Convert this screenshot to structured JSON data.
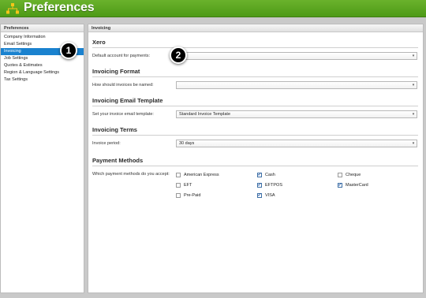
{
  "app": {
    "title": "Preferences",
    "logo_icon": "org-chart-icon"
  },
  "sidebar": {
    "heading": "Preferences",
    "items": [
      {
        "label": "Company Information"
      },
      {
        "label": "Email Settings"
      },
      {
        "label": "Invoicing",
        "active": true
      },
      {
        "label": "Job Settings"
      },
      {
        "label": "Quotes & Estimates"
      },
      {
        "label": "Region & Language Settings"
      },
      {
        "label": "Tax Settings"
      }
    ]
  },
  "main": {
    "heading": "Invoicing",
    "xero": {
      "title": "Xero",
      "label": "Default account for payments:",
      "value": ""
    },
    "format": {
      "title": "Invoicing Format",
      "label": "How should invoices be named:",
      "value": ""
    },
    "template": {
      "title": "Invoicing Email Template",
      "label": "Set your invoice email template:",
      "value": "Standard Invoice Template"
    },
    "terms": {
      "title": "Invoicing Terms",
      "label": "Invoice period:",
      "value": "30 days"
    },
    "payment": {
      "title": "Payment Methods",
      "label": "Which payment methods do you accept:",
      "methods": [
        {
          "label": "American Express",
          "checked": false
        },
        {
          "label": "Cash",
          "checked": true
        },
        {
          "label": "Cheque",
          "checked": false
        },
        {
          "label": "EFT",
          "checked": false
        },
        {
          "label": "EFTPOS",
          "checked": true
        },
        {
          "label": "MasterCard",
          "checked": true
        },
        {
          "label": "Pre-Paid",
          "checked": false
        },
        {
          "label": "VISA",
          "checked": true
        }
      ]
    }
  },
  "callouts": [
    {
      "label": "1"
    },
    {
      "label": "2"
    }
  ],
  "colors": {
    "header_green": "#5aa622",
    "active_blue": "#1a82cf"
  }
}
